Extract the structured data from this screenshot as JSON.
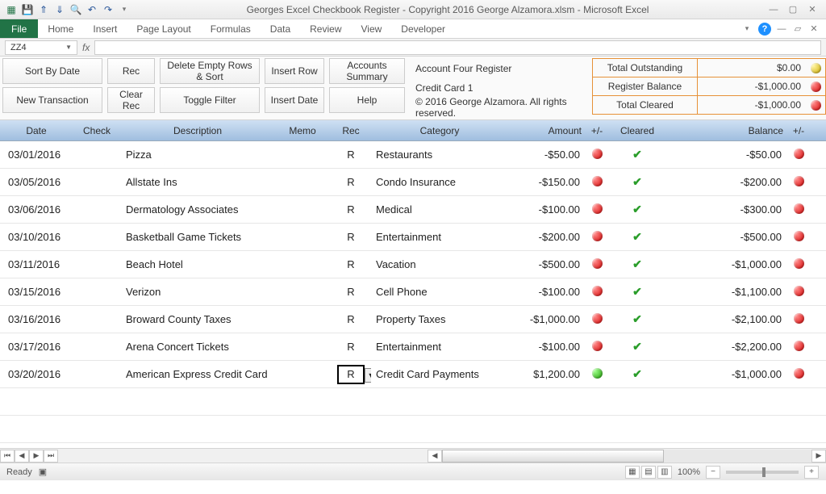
{
  "window": {
    "title": "Georges Excel Checkbook Register - Copyright 2016 George Alzamora.xlsm  -  Microsoft Excel",
    "name_box": "ZZ4"
  },
  "ribbon": {
    "file": "File",
    "tabs": [
      "Home",
      "Insert",
      "Page Layout",
      "Formulas",
      "Data",
      "Review",
      "View",
      "Developer"
    ]
  },
  "toolbar": {
    "sort_by_date": "Sort By Date",
    "rec": "Rec",
    "delete_empty": "Delete Empty Rows & Sort",
    "insert_row": "Insert Row",
    "accounts_summary": "Accounts Summary",
    "new_transaction": "New Transaction",
    "clear_rec": "Clear Rec",
    "toggle_filter": "Toggle Filter",
    "insert_date": "Insert Date",
    "help": "Help"
  },
  "info": {
    "line1": "Account Four Register",
    "line2": "Credit Card 1",
    "line3": "© 2016 George Alzamora.  All rights reserved."
  },
  "summary": {
    "rows": [
      {
        "label": "Total Outstanding",
        "value": "$0.00",
        "dot": "yellow"
      },
      {
        "label": "Register Balance",
        "value": "-$1,000.00",
        "dot": "red"
      },
      {
        "label": "Total Cleared",
        "value": "-$1,000.00",
        "dot": "red"
      }
    ]
  },
  "header": {
    "date": "Date",
    "check": "Check",
    "description": "Description",
    "memo": "Memo",
    "rec": "Rec",
    "category": "Category",
    "amount": "Amount",
    "pm": "+/-",
    "cleared": "Cleared",
    "balance": "Balance",
    "pm2": "+/-"
  },
  "dropdown": {
    "value": "R",
    "option": "R"
  },
  "rows": [
    {
      "date": "03/01/2016",
      "check": "",
      "desc": "Pizza",
      "memo": "",
      "rec": "R",
      "cat": "Restaurants",
      "amt": "-$50.00",
      "dot": "red",
      "clr": "✔",
      "bal": "-$50.00",
      "dot2": "red"
    },
    {
      "date": "03/05/2016",
      "check": "",
      "desc": "Allstate Ins",
      "memo": "",
      "rec": "R",
      "cat": "Condo Insurance",
      "amt": "-$150.00",
      "dot": "red",
      "clr": "✔",
      "bal": "-$200.00",
      "dot2": "red"
    },
    {
      "date": "03/06/2016",
      "check": "",
      "desc": "Dermatology Associates",
      "memo": "",
      "rec": "R",
      "cat": "Medical",
      "amt": "-$100.00",
      "dot": "red",
      "clr": "✔",
      "bal": "-$300.00",
      "dot2": "red"
    },
    {
      "date": "03/10/2016",
      "check": "",
      "desc": "Basketball Game Tickets",
      "memo": "",
      "rec": "R",
      "cat": "Entertainment",
      "amt": "-$200.00",
      "dot": "red",
      "clr": "✔",
      "bal": "-$500.00",
      "dot2": "red"
    },
    {
      "date": "03/11/2016",
      "check": "",
      "desc": "Beach Hotel",
      "memo": "",
      "rec": "R",
      "cat": "Vacation",
      "amt": "-$500.00",
      "dot": "red",
      "clr": "✔",
      "bal": "-$1,000.00",
      "dot2": "red"
    },
    {
      "date": "03/15/2016",
      "check": "",
      "desc": "Verizon",
      "memo": "",
      "rec": "R",
      "cat": "Cell Phone",
      "amt": "-$100.00",
      "dot": "red",
      "clr": "✔",
      "bal": "-$1,100.00",
      "dot2": "red"
    },
    {
      "date": "03/16/2016",
      "check": "",
      "desc": "Broward County Taxes",
      "memo": "",
      "rec": "R",
      "cat": "Property Taxes",
      "amt": "-$1,000.00",
      "dot": "red",
      "clr": "✔",
      "bal": "-$2,100.00",
      "dot2": "red"
    },
    {
      "date": "03/17/2016",
      "check": "",
      "desc": "Arena Concert Tickets",
      "memo": "",
      "rec": "R",
      "cat": "Entertainment",
      "amt": "-$100.00",
      "dot": "red",
      "clr": "✔",
      "bal": "-$2,200.00",
      "dot2": "red"
    },
    {
      "date": "03/20/2016",
      "check": "",
      "desc": "American Express Credit Card",
      "memo": "",
      "rec": "__DD__",
      "cat": "Credit Card Payments",
      "amt": "$1,200.00",
      "dot": "green",
      "clr": "✔",
      "bal": "-$1,000.00",
      "dot2": "red"
    }
  ],
  "status": {
    "ready": "Ready",
    "zoom": "100%"
  }
}
